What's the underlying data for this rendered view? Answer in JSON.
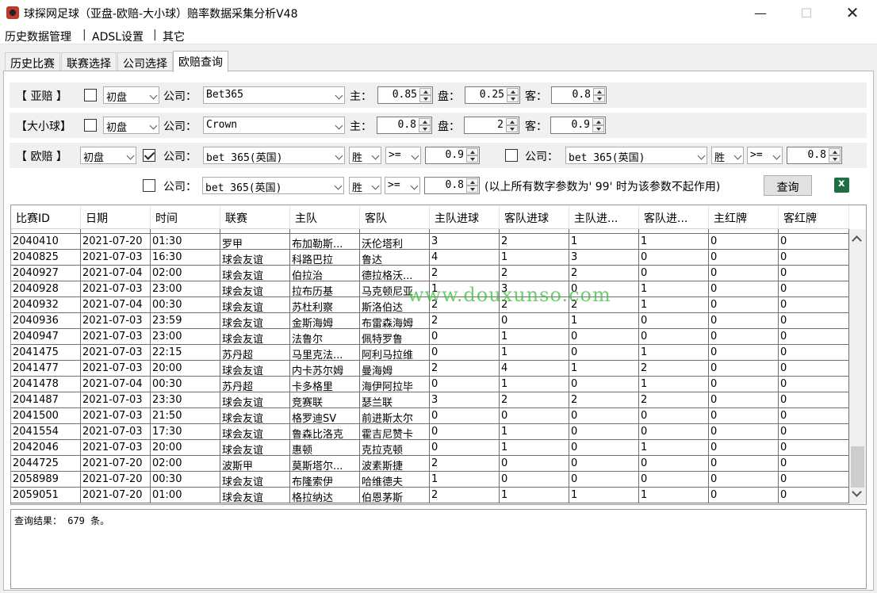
{
  "window": {
    "title": "球探网足球（亚盘-欧赔-大小球）赔率数据采集分析V48",
    "minimize_symbol": "—",
    "maximize_symbol": "☐",
    "close_symbol": "✕",
    "icon": "app-icon"
  },
  "menu": {
    "items": [
      "历史数据管理",
      "ADSL设置",
      "其它"
    ],
    "separator": "|"
  },
  "tabs": [
    {
      "label": "历史比赛",
      "active": false
    },
    {
      "label": "联赛选择",
      "active": false
    },
    {
      "label": "公司选择",
      "active": false
    },
    {
      "label": "欧赔查询",
      "active": true
    }
  ],
  "filters": {
    "asian": {
      "label": "【 亚赔 】",
      "checked": false,
      "stage": "初盘",
      "company_label": "公司：",
      "company": "Bet365",
      "home_label": "主：",
      "home": "0.85",
      "line_label": "盘：",
      "line": "0.25",
      "away_label": "客：",
      "away": "0.8"
    },
    "ou": {
      "label": "【大小球】",
      "checked": false,
      "stage": "初盘",
      "company_label": "公司：",
      "company": "Crown",
      "home_label": "主：",
      "home": "0.8",
      "line_label": "盘：",
      "line": "2",
      "away_label": "客：",
      "away": "0.9"
    },
    "euro": {
      "label": "【 欧赔 】",
      "stage": "初盘",
      "checked": true,
      "company_label": "公司：",
      "company": "bet 365(英国)",
      "result": "胜",
      "op": ">=",
      "value": "0.9",
      "checked2": false,
      "company2_label": "公司：",
      "company2": "bet 365(英国)",
      "result2": "胜",
      "op2": ">=",
      "value2": "0.8"
    },
    "euro3": {
      "checked": false,
      "company_label": "公司：",
      "company": "bet 365(英国)",
      "result": "胜",
      "op": ">=",
      "value": "0.8",
      "note": "(以上所有数字参数为' 99' 时为该参数不起作用)"
    },
    "query_button": "查询",
    "export_icon": "excel-icon"
  },
  "table": {
    "columns": [
      "比赛ID",
      "日期",
      "时间",
      "联赛",
      "主队",
      "客队",
      "主队进球",
      "客队进球",
      "主队进...",
      "客队进...",
      "主红牌",
      "客红牌"
    ],
    "rows": [
      [
        "2040410",
        "2021-07-20",
        "01:30",
        "罗甲",
        "布加勒斯...",
        "沃伦塔利",
        "3",
        "2",
        "1",
        "1",
        "0",
        "0"
      ],
      [
        "2040825",
        "2021-07-03",
        "16:30",
        "球会友谊",
        "科路巴拉",
        "鲁达",
        "4",
        "1",
        "3",
        "0",
        "0",
        "0"
      ],
      [
        "2040927",
        "2021-07-04",
        "02:00",
        "球会友谊",
        "伯拉治",
        "德拉格沃...",
        "2",
        "2",
        "2",
        "0",
        "0",
        "0"
      ],
      [
        "2040928",
        "2021-07-03",
        "23:00",
        "球会友谊",
        "拉布历基",
        "马克顿尼亚",
        "1",
        "3",
        "0",
        "1",
        "0",
        "0"
      ],
      [
        "2040932",
        "2021-07-04",
        "00:30",
        "球会友谊",
        "苏杜利察",
        "斯洛伯达",
        "2",
        "2",
        "2",
        "1",
        "0",
        "0"
      ],
      [
        "2040936",
        "2021-07-03",
        "23:59",
        "球会友谊",
        "金斯海姆",
        "布雷森海姆",
        "2",
        "0",
        "1",
        "0",
        "0",
        "0"
      ],
      [
        "2040947",
        "2021-07-03",
        "23:00",
        "球会友谊",
        "法鲁尔",
        "佩特罗鲁",
        "0",
        "1",
        "0",
        "0",
        "0",
        "0"
      ],
      [
        "2041475",
        "2021-07-03",
        "22:15",
        "苏丹超",
        "马里克法...",
        "阿利马拉维",
        "0",
        "1",
        "0",
        "1",
        "0",
        "0"
      ],
      [
        "2041477",
        "2021-07-03",
        "20:00",
        "球会友谊",
        "内卡苏尔姆",
        "曼海姆",
        "2",
        "4",
        "1",
        "2",
        "0",
        "0"
      ],
      [
        "2041478",
        "2021-07-04",
        "00:30",
        "苏丹超",
        "卡多格里",
        "海伊阿拉毕",
        "0",
        "1",
        "0",
        "1",
        "0",
        "0"
      ],
      [
        "2041487",
        "2021-07-03",
        "23:30",
        "球会友谊",
        "竞赛联",
        "瑟兰联",
        "3",
        "2",
        "2",
        "2",
        "0",
        "0"
      ],
      [
        "2041500",
        "2021-07-03",
        "21:50",
        "球会友谊",
        "格罗迪SV",
        "前进斯太尔",
        "0",
        "0",
        "0",
        "0",
        "0",
        "0"
      ],
      [
        "2041554",
        "2021-07-03",
        "17:30",
        "球会友谊",
        "鲁森比洛克",
        "霍吉尼赞卡",
        "0",
        "1",
        "0",
        "0",
        "0",
        "0"
      ],
      [
        "2042046",
        "2021-07-03",
        "20:00",
        "球会友谊",
        "惠顿",
        "克拉克顿",
        "0",
        "1",
        "0",
        "1",
        "0",
        "0"
      ],
      [
        "2044725",
        "2021-07-20",
        "02:00",
        "波斯甲",
        "莫斯塔尔...",
        "波素斯捷",
        "2",
        "0",
        "0",
        "0",
        "0",
        "0"
      ],
      [
        "2058989",
        "2021-07-20",
        "00:30",
        "球会友谊",
        "布隆索伊",
        "哈维德夫",
        "1",
        "0",
        "0",
        "0",
        "0",
        "0"
      ],
      [
        "2059051",
        "2021-07-20",
        "01:00",
        "球会友谊",
        "格拉纳达",
        "伯恩茅斯",
        "2",
        "1",
        "1",
        "1",
        "0",
        "0"
      ]
    ]
  },
  "watermark": "www.douxunso.com",
  "result": {
    "text": "查询结果： 679 条。"
  }
}
